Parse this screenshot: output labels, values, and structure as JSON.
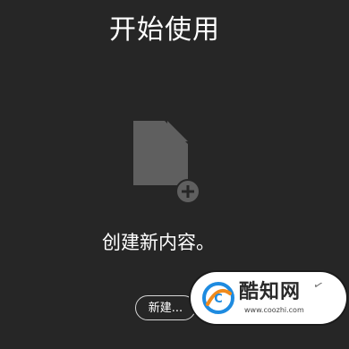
{
  "start": {
    "title": "开始使用",
    "subtitle": "创建新内容。",
    "new_button_label": "新建...",
    "icon": "new-document-icon"
  },
  "watermark": {
    "name": "酷知网",
    "url": "www.coozhi.com",
    "brand_colors": {
      "blue": "#1e8be0",
      "orange": "#f08a1c"
    }
  },
  "colors": {
    "background": "#262626",
    "icon_gray": "#5f5f5f",
    "text": "#ffffff"
  }
}
